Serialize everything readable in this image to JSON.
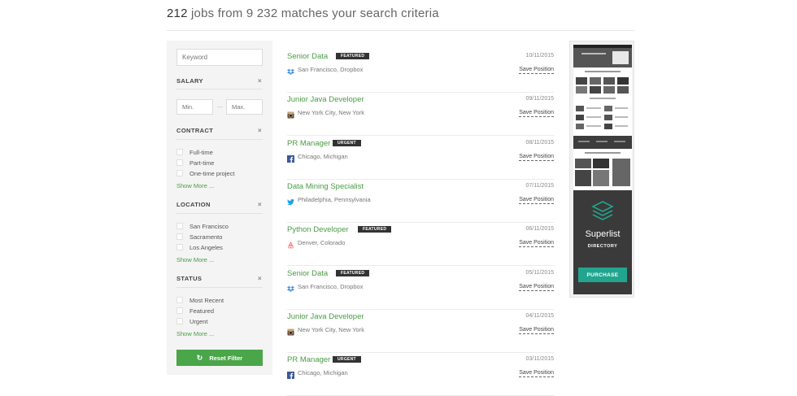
{
  "header": {
    "count": "212",
    "rest": " jobs from 9 232 matches your search criteria"
  },
  "filters": {
    "keyword_placeholder": "Keyword",
    "salary": {
      "title": "SALARY",
      "min_placeholder": "Min.",
      "max_placeholder": "Max.",
      "dash": "—"
    },
    "contract": {
      "title": "CONTRACT",
      "options": [
        "Full-time",
        "Part-time",
        "One-time project"
      ],
      "more": "Show More ..."
    },
    "location": {
      "title": "LOCATION",
      "options": [
        "San Francisco",
        "Sacramento",
        "Los Angeles"
      ],
      "more": "Show More ..."
    },
    "status": {
      "title": "STATUS",
      "options": [
        "Most Recent",
        "Featured",
        "Urgent"
      ],
      "more": "Show More ..."
    },
    "close_symbol": "×",
    "reset_label": "Reset Filter"
  },
  "jobs": [
    {
      "title": "Senior Data",
      "badge": "FEATURED",
      "date": "10/11/2015",
      "company": "San Francisco, Dropbox",
      "icon": "dropbox-icon",
      "save": "Save Position"
    },
    {
      "title": "Junior Java Developer",
      "badge": "",
      "date": "09/11/2015",
      "company": "New York City, New York",
      "icon": "instagram-icon",
      "save": "Save Position"
    },
    {
      "title": "PR Manager",
      "badge": "URGENT",
      "date": "08/11/2015",
      "company": "Chicago, Michigan",
      "icon": "facebook-icon",
      "save": "Save Position"
    },
    {
      "title": "Data Mining Specialist",
      "badge": "",
      "date": "07/11/2015",
      "company": "Philadelphia, Pennsylvania",
      "icon": "twitter-icon",
      "save": "Save Position"
    },
    {
      "title": "Python Developer",
      "badge": "FEATURED",
      "date": "06/11/2015",
      "company": "Denver, Colorado",
      "icon": "airbnb-icon",
      "save": "Save Position"
    },
    {
      "title": "Senior Data",
      "badge": "FEATURED",
      "date": "05/11/2015",
      "company": "San Francisco, Dropbox",
      "icon": "dropbox-icon",
      "save": "Save Position"
    },
    {
      "title": "Junior Java Developer",
      "badge": "",
      "date": "04/11/2015",
      "company": "New York City, New York",
      "icon": "instagram-icon",
      "save": "Save Position"
    },
    {
      "title": "PR Manager",
      "badge": "URGENT",
      "date": "03/11/2015",
      "company": "Chicago, Michigan",
      "icon": "facebook-icon",
      "save": "Save Position"
    }
  ],
  "ad": {
    "name": "Superlist",
    "sub": "DIRECTORY",
    "button": "PURCHASE",
    "icon": "layers-icon"
  },
  "colors": {
    "accent": "#4a9c46",
    "badge": "#333333",
    "ad_button": "#21a58e",
    "ad_dark": "#3a3a3a"
  }
}
